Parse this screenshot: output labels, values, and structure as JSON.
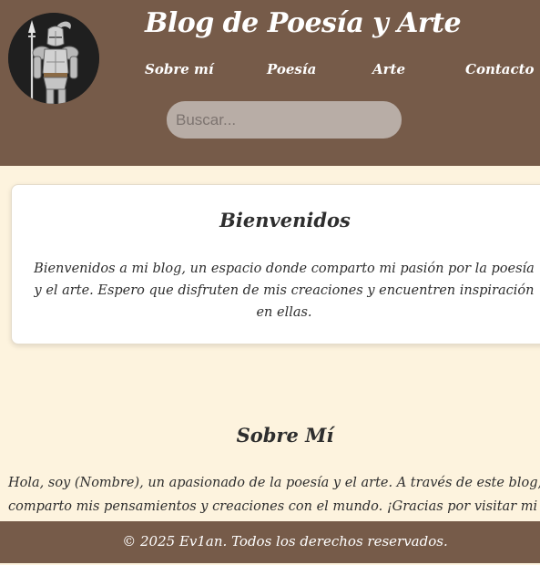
{
  "header": {
    "title": "Blog de Poesía y Arte",
    "avatar_alt": "knight-illustration",
    "nav": [
      {
        "label": "Sobre mí"
      },
      {
        "label": "Poesía"
      },
      {
        "label": "Arte"
      },
      {
        "label": "Contacto"
      }
    ],
    "search": {
      "placeholder": "Buscar...",
      "value": ""
    }
  },
  "welcome": {
    "title": "Bienvenidos",
    "text": "Bienvenidos a mi blog, un espacio donde comparto mi pasión por la poesía y el arte. Espero que disfruten de mis creaciones y encuentren inspiración en ellas."
  },
  "about": {
    "title": "Sobre Mí",
    "text": "Hola, soy (Nombre), un apasionado de la poesía y el arte. A través de este blog, comparto mis pensamientos y creaciones con el mundo. ¡Gracias por visitar mi"
  },
  "footer": {
    "text": "© 2025 Ev1an. Todos los derechos reservados."
  },
  "colors": {
    "header_bg": "#765b49",
    "page_bg": "#fdf3de",
    "search_bg": "#b8ada6",
    "card_bg": "#ffffff"
  }
}
